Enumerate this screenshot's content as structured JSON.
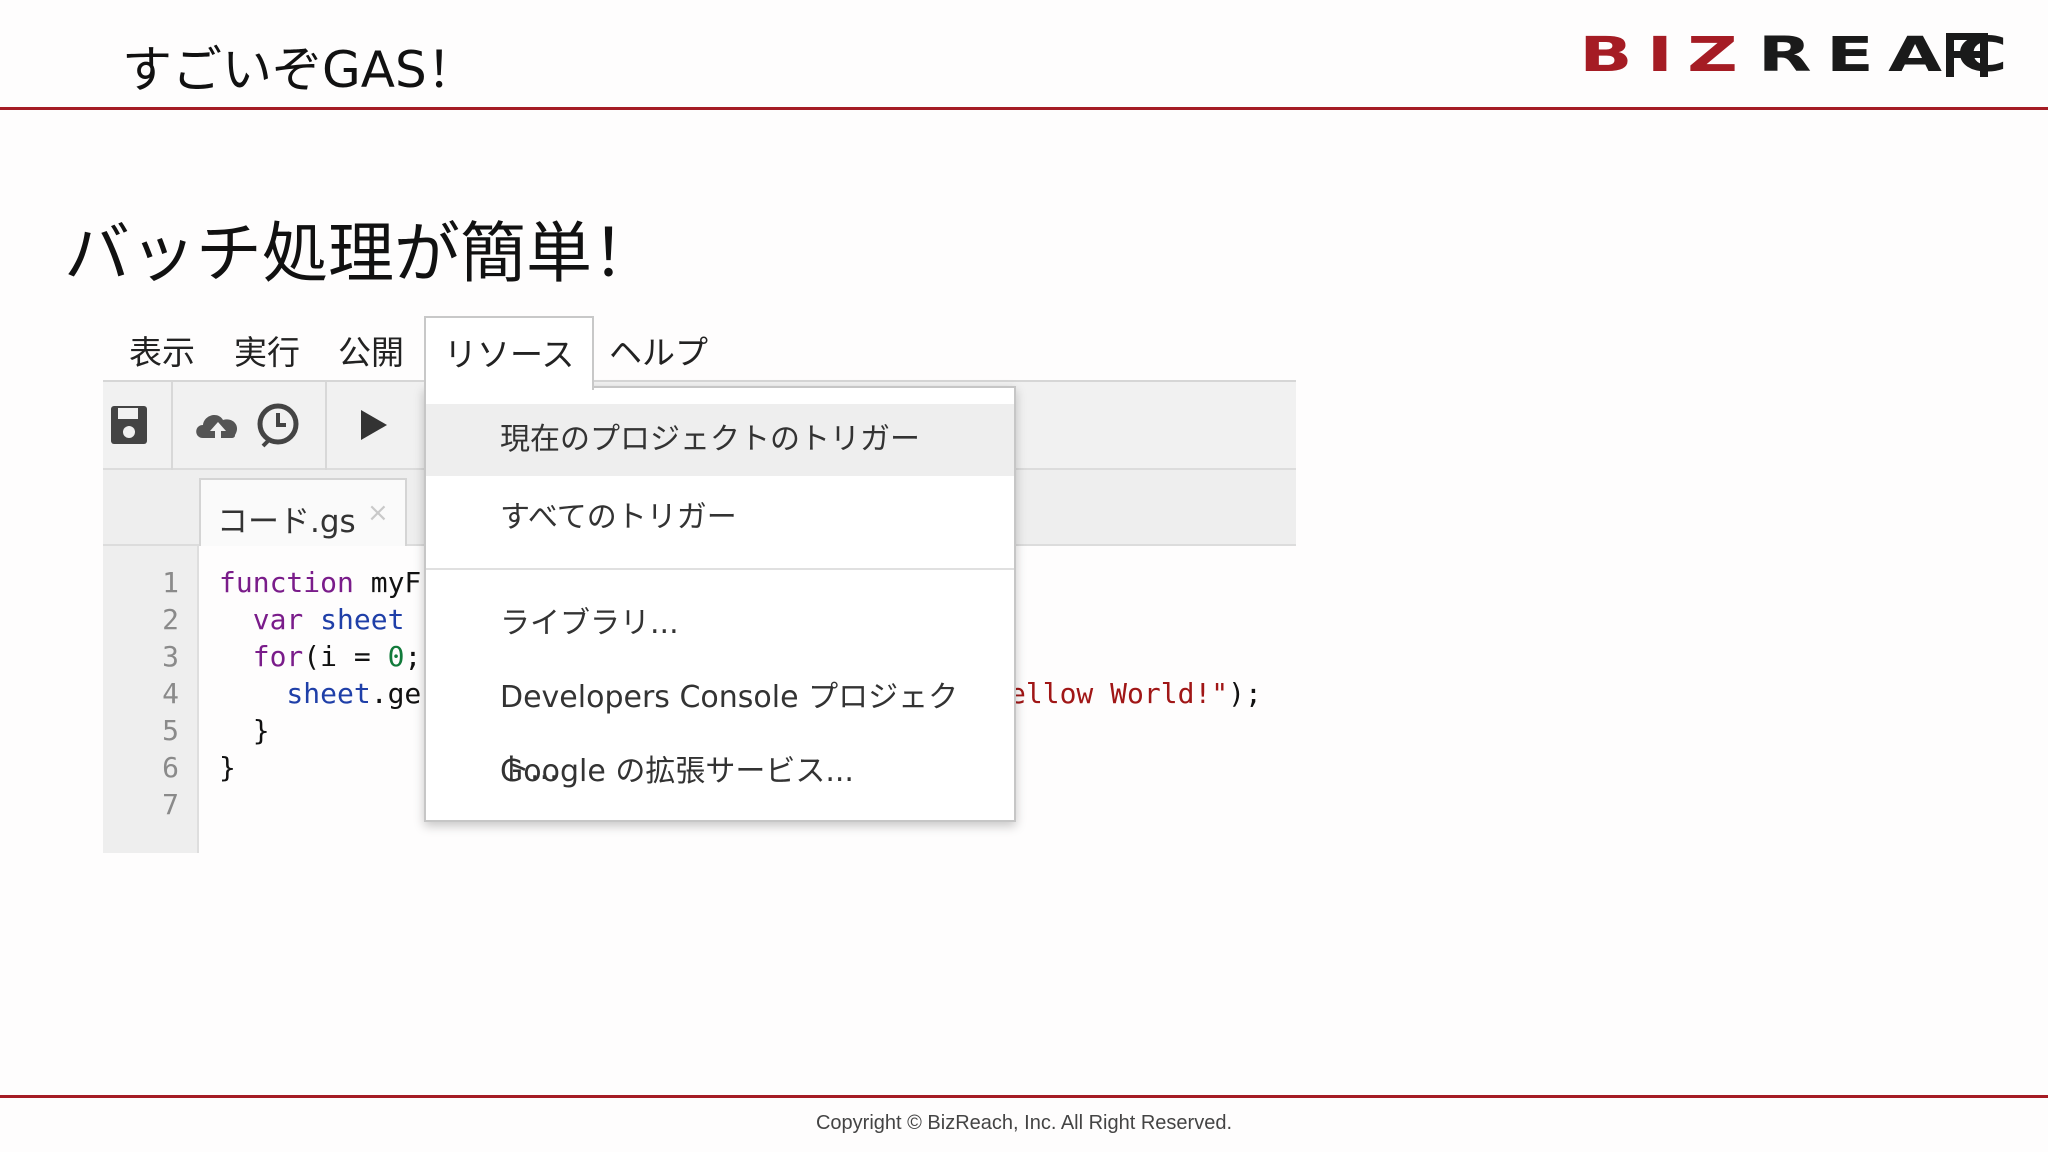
{
  "header": {
    "title": "すごいぞGAS！",
    "logo_text_red": "BIZ",
    "logo_text_dark": "REAC",
    "logo_name": "bizreach-logo",
    "brand_color": "#a51c24"
  },
  "subtitle": "バッチ処理が簡単！",
  "app": {
    "menu": [
      {
        "label": "表示"
      },
      {
        "label": "実行"
      },
      {
        "label": "公開"
      },
      {
        "label": "リソース",
        "active": true
      },
      {
        "label": "ヘルプ"
      }
    ],
    "toolbar_icons": [
      "save-icon",
      "cloud-upload-icon",
      "clock-trigger-icon",
      "run-icon"
    ],
    "tab": {
      "label": "コード.gs",
      "close": "×"
    },
    "line_numbers": [
      "1",
      "2",
      "3",
      "4",
      "5",
      "6",
      "7"
    ],
    "code": {
      "l1_kw": "function",
      "l1_rest": " myF",
      "l2_kw": "  var",
      "l2_var": " sheet",
      "l3_kw": "  for",
      "l3_a": "(i = ",
      "l3_num": "0",
      "l3_b": ";",
      "l4_var": "    sheet",
      "l4_rest": ".ge",
      "l4_str": "ellow World!\"",
      "l4_end": ");",
      "l5": "  }",
      "l6": "}"
    },
    "dropdown": {
      "items": [
        {
          "label": "現在のプロジェクトのトリガー",
          "highlighted": true
        },
        {
          "label": "すべてのトリガー"
        },
        {
          "label": "ライブラリ..."
        },
        {
          "label": "Developers Console プロジェクト..."
        },
        {
          "label": "Google の拡張サービス..."
        }
      ]
    }
  },
  "footer": {
    "copyright": "Copyright © BizReach, Inc. All Right Reserved."
  }
}
